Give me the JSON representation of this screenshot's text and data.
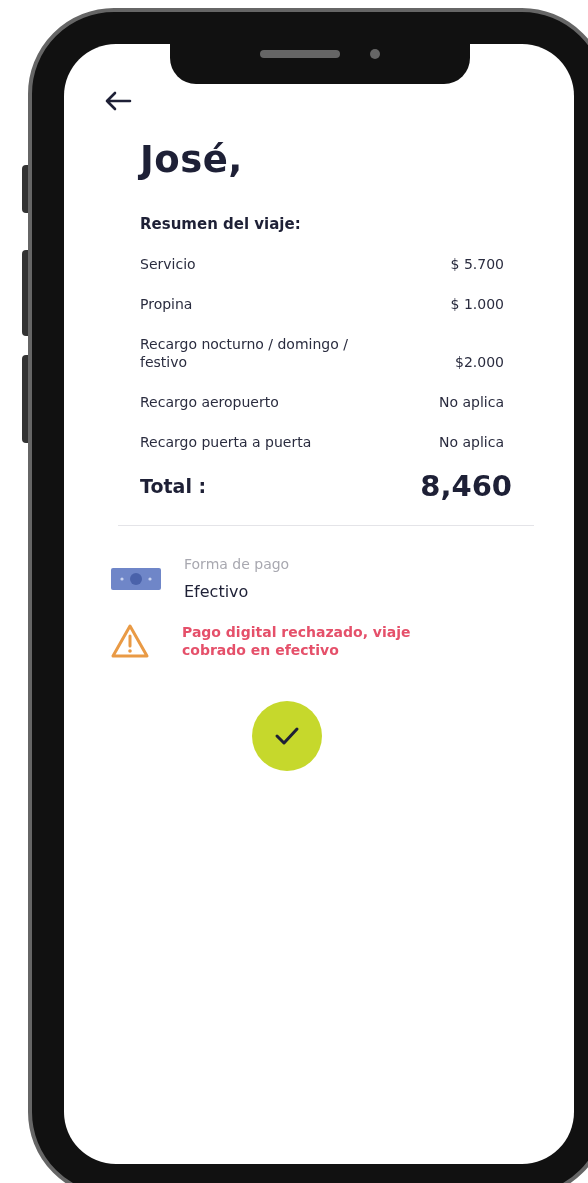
{
  "greeting": "José,",
  "summary": {
    "title": "Resumen del viaje:",
    "rows": [
      {
        "label": "Servicio",
        "value": "$ 5.700"
      },
      {
        "label": "Propina",
        "value": "$ 1.000"
      },
      {
        "label": "Recargo nocturno / domingo / festivo",
        "value": "$2.000"
      },
      {
        "label": "Recargo aeropuerto",
        "value": "No aplica"
      },
      {
        "label": "Recargo puerta a puerta",
        "value": "No aplica"
      }
    ],
    "total": {
      "label": "Total :",
      "value": "8,460"
    }
  },
  "payment": {
    "label": "Forma de pago",
    "value": "Efectivo"
  },
  "warning": "Pago digital rechazado, viaje cobrado en efectivo"
}
